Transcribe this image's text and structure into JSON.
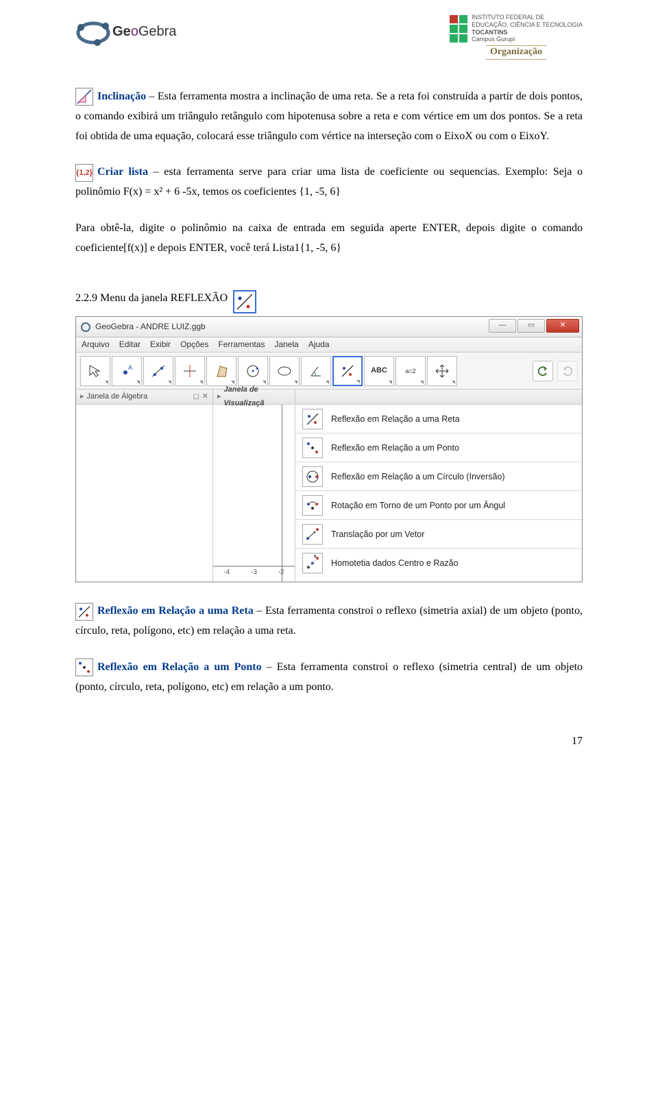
{
  "header": {
    "logo_text": "GeoGebra",
    "org_lines": [
      "INSTITUTO FEDERAL DE",
      "EDUCAÇÃO, CIÊNCIA E TECNOLOGIA",
      "TOCANTINS",
      "Campus Gurupi"
    ],
    "org_label": "Organização"
  },
  "tool_inclinacao": {
    "title": "Inclinação",
    "body1": " – Esta ferramenta mostra a inclinação de uma reta. Se a reta foi construída a partir de dois pontos, o comando exibirá um triângulo retângulo com hipotenusa sobre a reta e com vértice em um dos pontos. Se a reta foi obtida de uma equação, colocará esse triângulo com vértice na interseção com o EixoX ou com o EixoY."
  },
  "tool_criar_lista": {
    "icon_text": "{1,2}",
    "title": "Criar lista",
    "body1": " – esta ferramenta serve para criar uma lista de coeficiente ou sequencias. Exemplo: Seja o polinômio F(x) = x² + 6 -5x, temos os coeficientes {1, -5, 6}",
    "body2": "Para obtê-la, digite o polinômio na caixa de entrada em seguida aperte ENTER, depois digite o comando coeficiente[f(x)]  e depois ENTER, você terá Lista1{1, -5, 6}"
  },
  "section": {
    "title": "2.2.9 Menu da janela REFLEXÃO"
  },
  "app": {
    "title": "GeoGebra - ANDRE LUIZ.ggb",
    "menubar": [
      "Arquivo",
      "Editar",
      "Exibir",
      "Opções",
      "Ferramentas",
      "Janela",
      "Ajuda"
    ],
    "toolbar_text": {
      "abc": "ABC",
      "slider": "a=2"
    },
    "panel_left_title": "Janela de Álgebra",
    "panel_mid_title": "Janela de Visualizaçã",
    "axis_ticks": [
      "-4",
      "-3",
      "-2"
    ],
    "dropdown": [
      "Reflexão em Relação a uma Reta",
      "Reflexão em Relação a um Ponto",
      "Reflexão em Relação a um Círculo (Inversão)",
      "Rotação em Torno de um Ponto por um Ângul",
      "Translação por um Vetor",
      "Homotetia dados Centro e Razão"
    ]
  },
  "tool_reflexao_reta": {
    "title": "Reflexão em Relação a uma Reta",
    "body": " – Esta ferramenta constroi o reflexo (simetria axial) de um objeto (ponto, círculo, reta, polígono, etc) em relação a uma reta."
  },
  "tool_reflexao_ponto": {
    "title": "Reflexão em Relação a um Ponto",
    "body": " – Esta ferramenta constroi o reflexo (simetria central) de um objeto (ponto, círculo, reta, polígono, etc) em relação a um ponto."
  },
  "page_number": "17"
}
